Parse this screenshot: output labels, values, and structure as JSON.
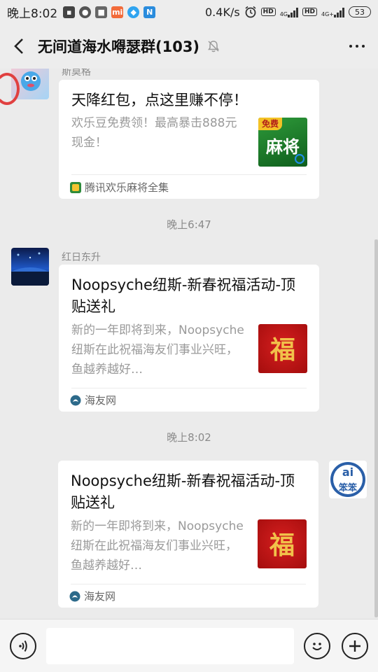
{
  "status_bar": {
    "time": "晚上8:02",
    "net_speed": "0.4K/s",
    "net_tag_1": "4G",
    "net_tag_2": "4G+",
    "hd_label": "HD",
    "battery": "53"
  },
  "header": {
    "title": "无间道海水嘚瑟群(103)",
    "back_icon": "back-arrow-icon",
    "mute_icon": "bell-muted-icon",
    "more_icon": "more-dots-icon"
  },
  "messages": [
    {
      "sender": "斯莫格",
      "card_title": "天降红包，点这里赚不停！",
      "card_desc": "欢乐豆免费领！最高暴击888元现金！",
      "thumb_tag": "免费",
      "thumb_text": "麻将",
      "source": "腾讯欢乐麻将全集"
    },
    {
      "timestamp": "晚上6:47",
      "sender": "红日东升",
      "card_title": "Noopsyche纽斯-新春祝福活动-顶贴送礼",
      "card_desc": "新的一年即将到来，Noopsyche纽斯在此祝福海友们事业兴旺，鱼越养越好…",
      "thumb_text": "福",
      "source": "海友网"
    },
    {
      "timestamp": "晚上8:02",
      "avatar_text": "笨笨",
      "card_title": "Noopsyche纽斯-新春祝福活动-顶贴送礼",
      "card_desc": "新的一年即将到来，Noopsyche纽斯在此祝福海友们事业兴旺，鱼越养越好…",
      "thumb_text": "福",
      "source": "海友网"
    }
  ],
  "input_bar": {
    "voice_icon": "voice-icon",
    "emoji_icon": "emoji-icon",
    "add_icon": "add-icon",
    "input_value": ""
  }
}
